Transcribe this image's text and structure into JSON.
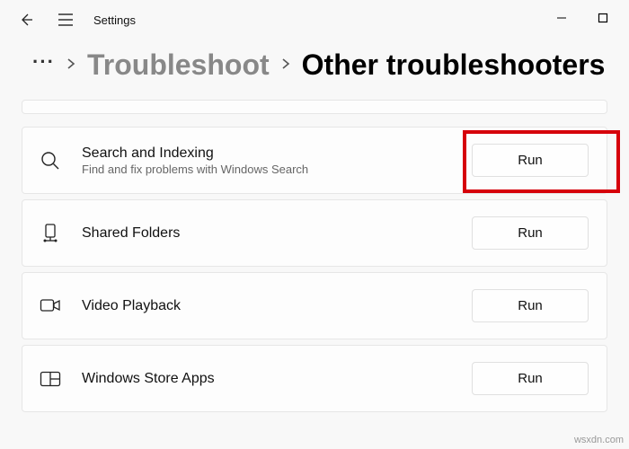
{
  "header": {
    "app_title": "Settings"
  },
  "breadcrumb": {
    "parent": "Troubleshoot",
    "current": "Other troubleshooters"
  },
  "buttons": {
    "run": "Run"
  },
  "items": [
    {
      "title": "Search and Indexing",
      "desc": "Find and fix problems with Windows Search",
      "icon": "search-icon"
    },
    {
      "title": "Shared Folders",
      "desc": "",
      "icon": "shared-folders-icon"
    },
    {
      "title": "Video Playback",
      "desc": "",
      "icon": "video-icon"
    },
    {
      "title": "Windows Store Apps",
      "desc": "",
      "icon": "store-icon"
    }
  ],
  "watermark": "wsxdn.com"
}
